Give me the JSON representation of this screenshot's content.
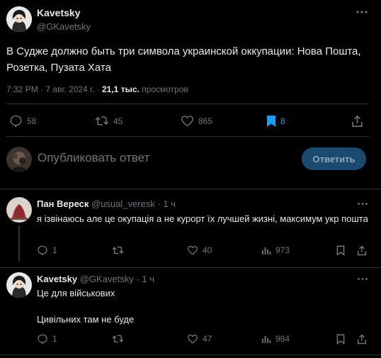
{
  "main_tweet": {
    "author_name": "Kavetsky",
    "author_handle": "@GKavetsky",
    "text": "В Судже должно быть три символа украинской оккупации: Нова Пошта, Розетка, Пузата Хата",
    "time": "7:32 PM",
    "sep": "·",
    "date": "7 авг. 2024 г.",
    "views_count": "21,1 тыс.",
    "views_label": "просмотров",
    "replies": "58",
    "retweets": "45",
    "likes": "865",
    "bookmarks": "8"
  },
  "composer": {
    "placeholder": "Опубликовать ответ",
    "button_label": "Ответить"
  },
  "replies": [
    {
      "author_name": "Пан Вереск",
      "author_handle": "@usual_veresk",
      "time": "· 1 ч",
      "text": "я ізвінаюсь але це окупація а не курорт їх лучшей жизні, максимум укр пошта",
      "replies": "1",
      "retweets": "",
      "likes": "40",
      "views": "973"
    },
    {
      "author_name": "Kavetsky",
      "author_handle": "@GKavetsky",
      "time": "· 1 ч",
      "text_line1": "Це для військових",
      "text_line2": "Цивільних там не буде",
      "replies": "1",
      "retweets": "",
      "likes": "47",
      "views": "984"
    }
  ],
  "colors": {
    "background": "#000000",
    "text": "#e7e9ea",
    "muted": "#71767b",
    "accent": "#1d9bf0",
    "divider": "#2f3336"
  }
}
